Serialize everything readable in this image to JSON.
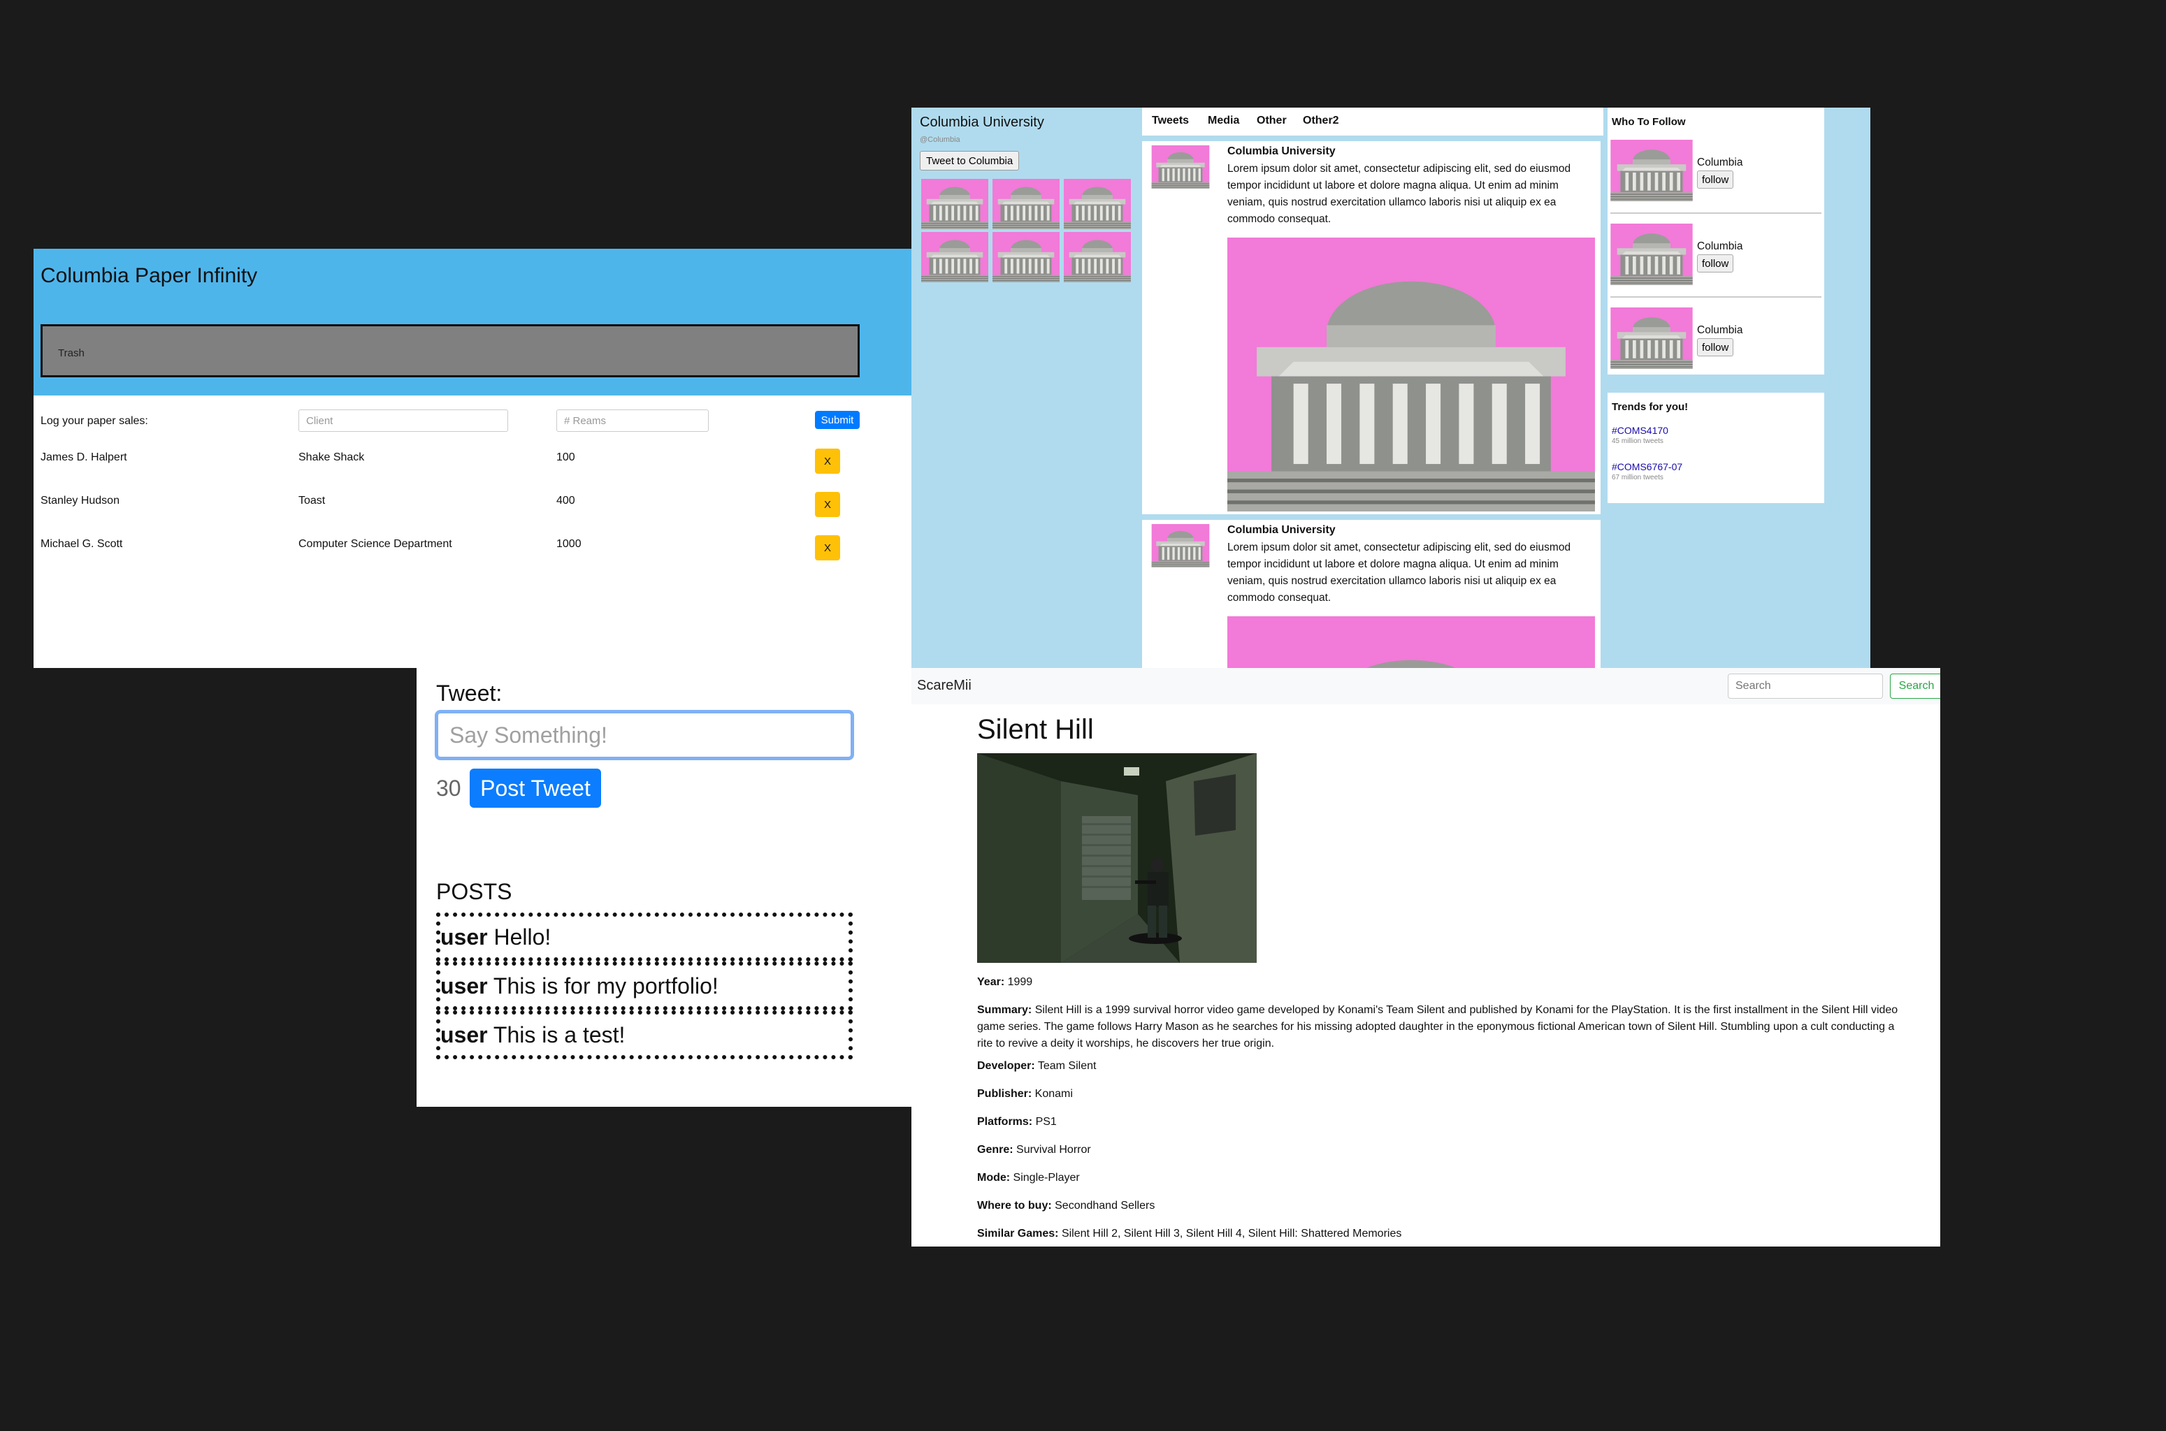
{
  "paper": {
    "title": "Columbia Paper Infinity",
    "trash_label": "Trash",
    "log_label": "Log your paper sales:",
    "client_placeholder": "Client",
    "reams_placeholder": "# Reams",
    "submit_label": "Submit",
    "delete_label": "X",
    "sales": [
      {
        "name": "James D. Halpert",
        "client": "Shake Shack",
        "reams": "100"
      },
      {
        "name": "Stanley Hudson",
        "client": "Toast",
        "reams": "400"
      },
      {
        "name": "Michael G. Scott",
        "client": "Computer Science Department",
        "reams": "1000"
      }
    ]
  },
  "twitter": {
    "profile_name": "Columbia University",
    "handle": "@Columbia",
    "tweet_to_label": "Tweet to Columbia",
    "tabs": [
      "Tweets",
      "Media",
      "Other",
      "Other2"
    ],
    "tweets": [
      {
        "author": "Columbia University",
        "body": "Lorem ipsum dolor sit amet, consectetur adipiscing elit, sed do eiusmod tempor incididunt ut labore et dolore magna aliqua. Ut enim ad minim veniam, quis nostrud exercitation ullamco laboris nisi ut aliquip ex ea commodo consequat."
      },
      {
        "author": "Columbia University",
        "body": "Lorem ipsum dolor sit amet, consectetur adipiscing elit, sed do eiusmod tempor incididunt ut labore et dolore magna aliqua. Ut enim ad minim veniam, quis nostrud exercitation ullamco laboris nisi ut aliquip ex ea commodo consequat."
      }
    ],
    "who_to_follow_title": "Who To Follow",
    "suggestions": [
      {
        "name": "Columbia",
        "follow_label": "follow"
      },
      {
        "name": "Columbia",
        "follow_label": "follow"
      },
      {
        "name": "Columbia",
        "follow_label": "follow"
      }
    ],
    "trends_title": "Trends for you!",
    "trends": [
      {
        "tag": "#COMS4170",
        "count": "45 million tweets"
      },
      {
        "tag": "#COMS6767-07",
        "count": "67 million tweets"
      }
    ],
    "colors": {
      "background": "#b0dbee",
      "image_tint": "#f27ad8"
    }
  },
  "posts": {
    "tweet_label": "Tweet:",
    "input_placeholder": "Say Something!",
    "char_count": "30",
    "post_button": "Post Tweet",
    "posts_title": "POSTS",
    "items": [
      {
        "user": "user",
        "text": " Hello!"
      },
      {
        "user": "user",
        "text": " This is for my portfolio!"
      },
      {
        "user": "user",
        "text": " This is a test!"
      }
    ]
  },
  "scaremii": {
    "brand": "ScareMii",
    "search_placeholder": "Search",
    "search_button": "Search",
    "game_title": "Silent Hill",
    "fields": [
      {
        "label": "Year:",
        "value": " 1999"
      },
      {
        "label": "Summary:",
        "value": " Silent Hill is a 1999 survival horror video game developed by Konami's Team Silent and published by Konami for the PlayStation. It is the first installment in the Silent Hill video game series. The game follows Harry Mason as he searches for his missing adopted daughter in the eponymous fictional American town of Silent Hill. Stumbling upon a cult conducting a rite to revive a deity it worships, he discovers her true origin."
      },
      {
        "label": "Developer:",
        "value": " Team Silent"
      },
      {
        "label": "Publisher:",
        "value": " Konami"
      },
      {
        "label": "Platforms:",
        "value": " PS1"
      },
      {
        "label": "Genre:",
        "value": " Survival Horror"
      },
      {
        "label": "Mode:",
        "value": " Single-Player"
      },
      {
        "label": "Where to buy:",
        "value": " Secondhand Sellers"
      },
      {
        "label": "Similar Games:",
        "value": " Silent Hill 2, Silent Hill 3, Silent Hill 4, Silent Hill: Shattered Memories"
      }
    ]
  }
}
